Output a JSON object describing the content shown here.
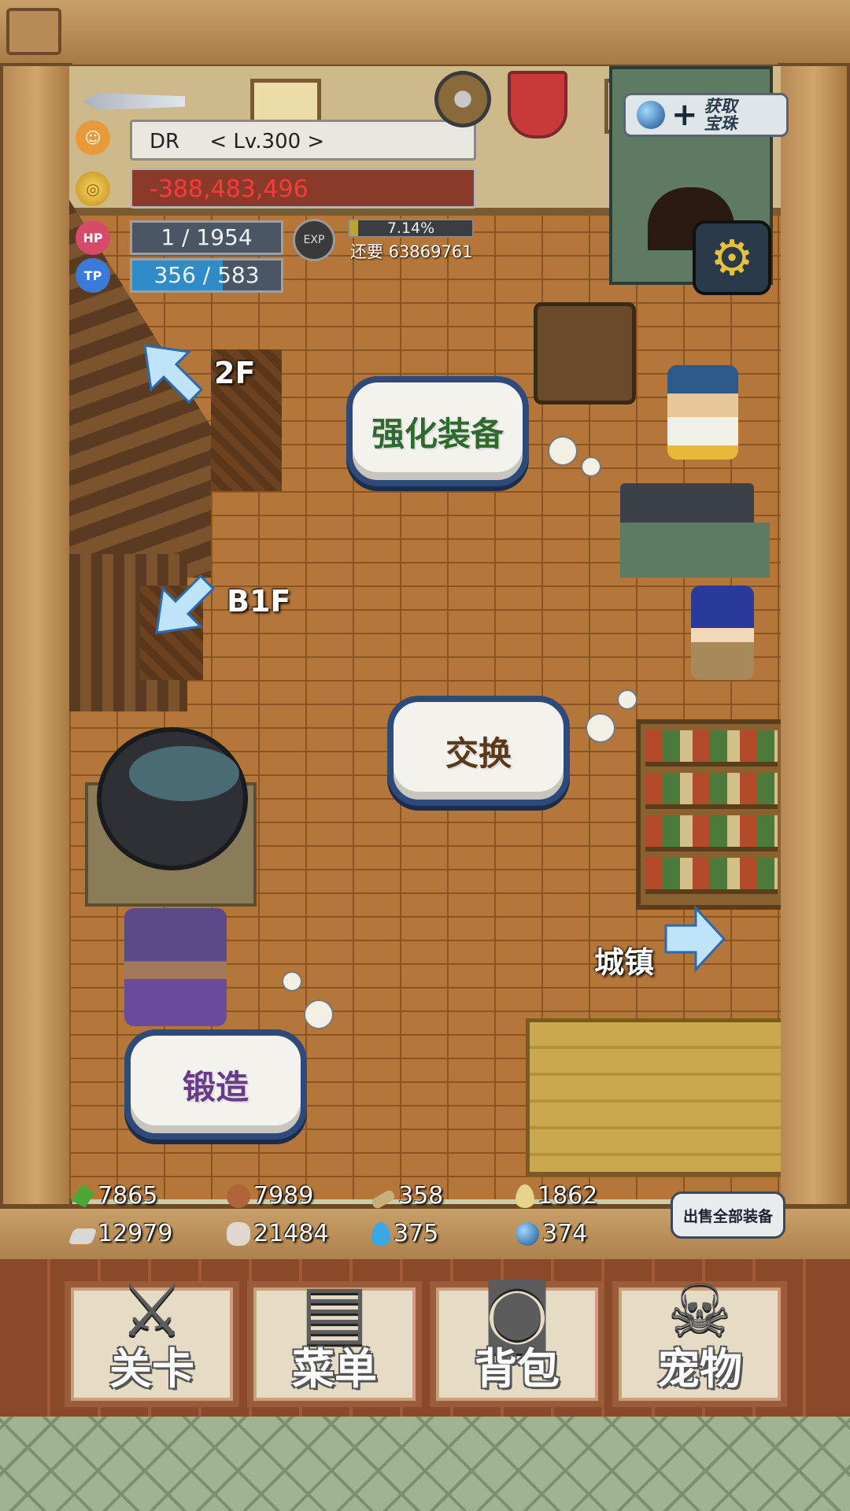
{
  "player": {
    "name": "DR",
    "level": "< Lv.300 >",
    "gold": "-388,483,496",
    "hp": "1 / 1954",
    "tp": "356 / 583",
    "tp_fraction": 0.61,
    "exp_badge": "EXP",
    "exp_percent": "7.14%",
    "exp_fraction": 0.0714,
    "exp_remaining": "还要 63869761",
    "hp_badge": "HP",
    "tp_badge": "TP"
  },
  "top_buttons": {
    "get_orbs": "获取宝珠",
    "settings_icon": "gear-icon"
  },
  "map": {
    "to_2f": "2F",
    "to_b1f": "B1F",
    "to_town": "城镇"
  },
  "actions": {
    "enhance": "强化装备",
    "exchange": "交换",
    "forge": "锻造"
  },
  "resources": [
    {
      "icon": "herb-icon",
      "value": "7865",
      "color": "#4aa83a"
    },
    {
      "icon": "wood-icon",
      "value": "7989",
      "color": "#b0643a"
    },
    {
      "icon": "plank-icon",
      "value": "358",
      "color": "#c8b07a"
    },
    {
      "icon": "flame-drop-icon",
      "value": "1862",
      "color": "#e8d38a"
    },
    {
      "icon": "iron-ingot-icon",
      "value": "12979",
      "color": "#d8d8d8"
    },
    {
      "icon": "stone-icon",
      "value": "21484",
      "color": "#e0d8d0"
    },
    {
      "icon": "blue-flame-icon",
      "value": "375",
      "color": "#3aa8e8"
    },
    {
      "icon": "blue-orb-icon",
      "value": "374",
      "color": "#1a6ab0"
    }
  ],
  "sell_all": "出售全部装备",
  "nav": [
    {
      "icon": "crossed-swords-icon",
      "label": "关卡"
    },
    {
      "icon": "book-icon",
      "label": "菜单"
    },
    {
      "icon": "backpack-icon",
      "label": "背包"
    },
    {
      "icon": "dragon-icon",
      "label": "宠物"
    }
  ],
  "colors": {
    "gold_negative": "#ff3a3a",
    "button_border": "#2e4a7a",
    "enhance_text": "#2e6a2e",
    "exchange_text": "#5a3a1a",
    "forge_text": "#6a3a8a"
  }
}
